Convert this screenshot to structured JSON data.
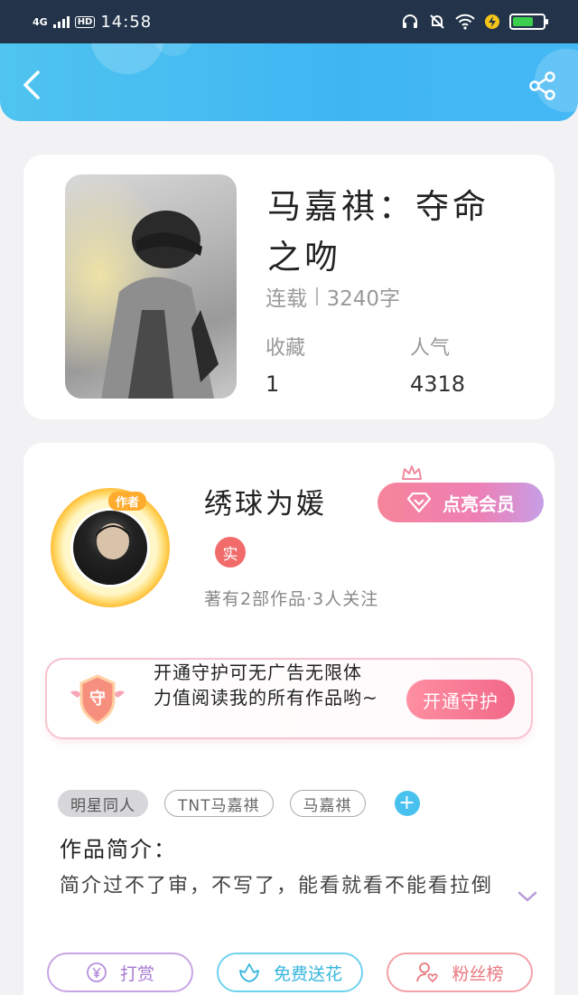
{
  "status_bar": {
    "network": "4G",
    "hd": "HD",
    "time": "14:58",
    "battery_label": "",
    "colors": {
      "background": "#23344a",
      "battery_fill": "#3ccf4e"
    }
  },
  "header": {
    "back_icon": "chevron-left-icon",
    "share_icon": "share-icon",
    "gradient": [
      "#4fc4f0",
      "#45b8f4"
    ]
  },
  "book": {
    "title": "马嘉祺：夺命之吻",
    "status": "连载",
    "word_count": "3240字",
    "stats": [
      {
        "label": "收藏",
        "value": "1"
      },
      {
        "label": "人气",
        "value": "4318"
      }
    ]
  },
  "author": {
    "badge": "作者",
    "name": "绣球为媛",
    "verified_label": "实",
    "summary": "著有2部作品·3人关注",
    "vip_button": "点亮会员"
  },
  "guard_banner": {
    "shield_label": "守",
    "text": "开通守护可无广告无限体力值阅读我的所有作品哟~",
    "button": "开通守护"
  },
  "tags": [
    "明星同人",
    "TNT马嘉祺",
    "马嘉祺"
  ],
  "intro": {
    "title": "作品简介：",
    "text": "简介过不了审，不写了，能看就看不能看拉倒"
  },
  "actions": [
    {
      "label": "打赏",
      "icon": "yen-coin-icon"
    },
    {
      "label": "免费送花",
      "icon": "flower-icon"
    },
    {
      "label": "粉丝榜",
      "icon": "user-heart-icon"
    }
  ]
}
